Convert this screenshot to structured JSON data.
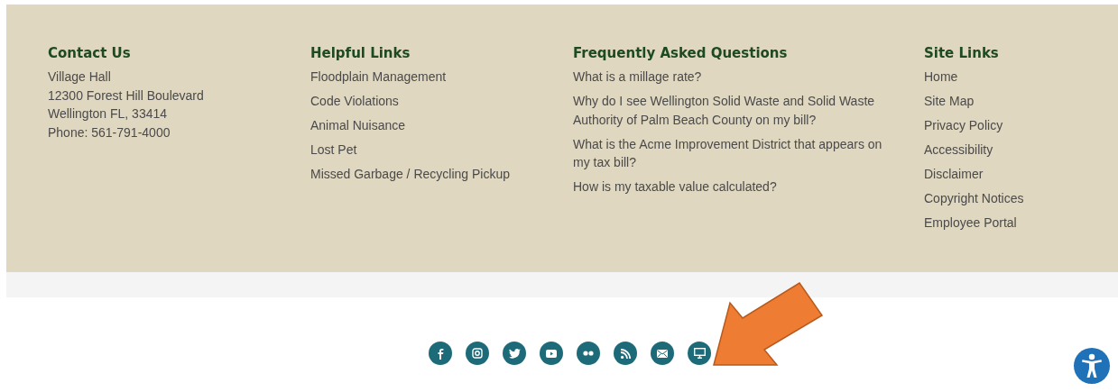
{
  "footer": {
    "columns": [
      {
        "kind": "address",
        "heading": "Contact Us",
        "lines": [
          "Village Hall",
          "12300 Forest Hill Boulevard",
          "Wellington FL, 33414",
          "Phone: 561-791-4000"
        ]
      },
      {
        "kind": "links",
        "heading": "Helpful Links",
        "lines": [
          "Floodplain Management",
          "Code Violations",
          "Animal Nuisance",
          "Lost Pet",
          "Missed Garbage / Recycling Pickup"
        ]
      },
      {
        "kind": "links",
        "heading": "Frequently Asked Questions",
        "lines": [
          "What is a millage rate?",
          "Why do I see Wellington Solid Waste and Solid Waste Authority of Palm Beach County on my bill?",
          "What is the Acme Improvement District that appears on my tax bill?",
          "How is my taxable value calculated?"
        ]
      },
      {
        "kind": "links",
        "heading": "Site Links",
        "lines": [
          "Home",
          "Site Map",
          "Privacy Policy",
          "Accessibility",
          "Disclaimer",
          "Copyright Notices",
          "Employee Portal"
        ]
      }
    ]
  }
}
